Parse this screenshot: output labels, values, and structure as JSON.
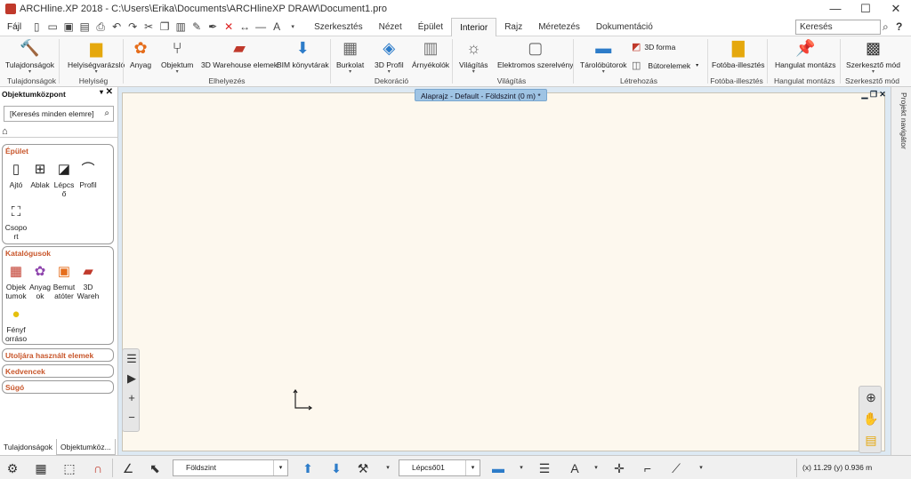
{
  "window": {
    "title": "ARCHline.XP 2018 - C:\\Users\\Erika\\Documents\\ARCHlineXP DRAW\\Document1.pro",
    "minimize": "—",
    "maximize": "☐",
    "close": "✕"
  },
  "menu": {
    "file_tab": "Fájl",
    "tabs": [
      "Szerkesztés",
      "Nézet",
      "Épület",
      "Interior",
      "Rajz",
      "Méretezés",
      "Dokumentáció"
    ],
    "active_tab": "Interior",
    "search_value": "Keresés"
  },
  "ribbon": {
    "buttons": [
      {
        "label": "Tulajdonságok",
        "icon": "properties-icon"
      },
      {
        "label": "Helyiségvarázsló",
        "icon": "room-wizard-icon"
      },
      {
        "label": "Anyag",
        "icon": "material-icon"
      },
      {
        "label": "Objektum",
        "icon": "object-icon"
      },
      {
        "label": "3D Warehouse elemek",
        "icon": "3d-warehouse-icon"
      },
      {
        "label": "BIM könyvtárak",
        "icon": "bim-library-icon"
      },
      {
        "label": "Burkolat",
        "icon": "cladding-icon"
      },
      {
        "label": "3D Profil",
        "icon": "3d-profile-icon"
      },
      {
        "label": "Árnyékolók",
        "icon": "shading-icon"
      },
      {
        "label": "Világítás",
        "icon": "lighting-icon"
      },
      {
        "label": "Elektromos szerelvény",
        "icon": "electrical-icon"
      },
      {
        "label": "Tárolóbútorok",
        "icon": "storage-furniture-icon"
      },
      {
        "label": "3D forma",
        "icon": "3d-form-icon"
      },
      {
        "label": "Bútorelemek",
        "icon": "furniture-elements-icon"
      },
      {
        "label": "Fotóba-illesztés",
        "icon": "photo-fit-icon"
      },
      {
        "label": "Hangulat montázs",
        "icon": "mood-board-icon"
      },
      {
        "label": "Szerkesztő mód",
        "icon": "editor-mode-icon"
      }
    ],
    "groups": [
      "Tulajdonságok",
      "Helyiség",
      "Elhelyezés",
      "Dekoráció",
      "Világítás",
      "Létrehozás",
      "Fotóba-illesztés",
      "Hangulat montázs",
      "Szerkesztő mód"
    ]
  },
  "left_panel": {
    "title": "Objektumközpont",
    "search_placeholder": "[Keresés minden elemre]",
    "sections": {
      "epulet": {
        "title": "Épület",
        "items": [
          "Ajtó",
          "Ablak",
          "Lépcs ő",
          "Profil",
          "Csopo rt"
        ]
      },
      "katalogusok": {
        "title": "Katalógusok",
        "items": [
          "Objek tumok",
          "Anyag ok",
          "Bemut atóter",
          "3D Wareh",
          "Fényf orráso"
        ]
      },
      "collapsed": [
        "Utoljára használt elemek",
        "Kedvencek",
        "Súgó"
      ]
    },
    "bottom_tabs": [
      "Tulajdonságok",
      "Objektumköz..."
    ]
  },
  "canvas": {
    "doc_title": "Alaprajz - Default - Földszint (0 m) *",
    "right_tab": "Projekt navigátor"
  },
  "statusbar": {
    "floor_select": "Földszint",
    "layer_select": "Lépcső01",
    "coords": "(x) 11.29   (y) 0.936 m"
  },
  "colors": {
    "accent": "#c8562b",
    "canvas_bg": "#fdf8ee",
    "doc_title_bg": "#9fc4e4"
  }
}
